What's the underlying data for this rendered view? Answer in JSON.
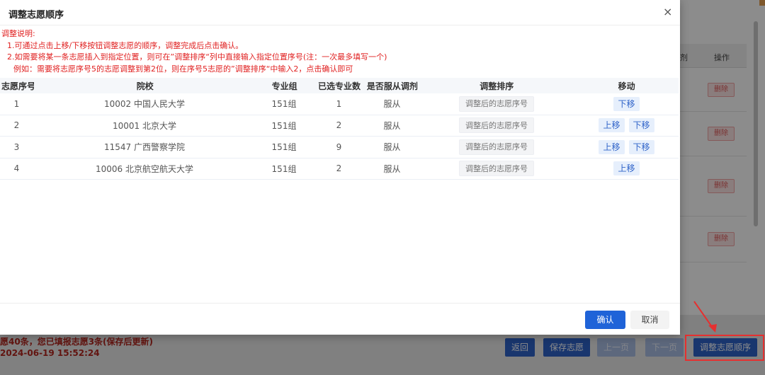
{
  "modal": {
    "title": "调整志愿顺序",
    "close_glyph": "×",
    "notes": {
      "heading": "调整说明:",
      "line1": "1.可通过点击上移/下移按钮调整志愿的顺序，调整完成后点击确认。",
      "line2": "2.如需要将某一条志愿插入到指定位置，则可在”调整排序“列中直接输入指定位置序号(注：一次最多填写一个)",
      "line3": "例如：需要将志愿序号5的志愿调整到第2位，则在序号5志愿的”调整排序“中输入2，点击确认即可"
    },
    "table": {
      "headers": [
        "志愿序号",
        "院校",
        "专业组",
        "已选专业数",
        "是否服从调剂",
        "调整排序",
        "移动"
      ],
      "rank_placeholder": "调整后的志愿序号",
      "up_label": "上移",
      "down_label": "下移",
      "rows": [
        {
          "index": "1",
          "school": "10002 中国人民大学",
          "group": "151组",
          "count": "1",
          "obey": "服从"
        },
        {
          "index": "2",
          "school": "10001 北京大学",
          "group": "151组",
          "count": "2",
          "obey": "服从"
        },
        {
          "index": "3",
          "school": "11547 广西警察学院",
          "group": "151组",
          "count": "9",
          "obey": "服从"
        },
        {
          "index": "4",
          "school": "10006 北京航空航天大学",
          "group": "151组",
          "count": "2",
          "obey": "服从"
        }
      ]
    },
    "footer": {
      "confirm_label": "确认",
      "cancel_label": "取消"
    }
  },
  "background": {
    "column_partial": "剂",
    "column_actions": "操作",
    "delete_label": "删除",
    "note_line1": "愿40条，您已填报志愿3条(保存后更新)",
    "note_line2": "2024-06-19 15:52:24",
    "buttons": {
      "back": "返回",
      "save": "保存志愿",
      "prev": "上一页",
      "next": "下一页",
      "adjust": "调整志愿顺序"
    }
  },
  "colors": {
    "primary": "#1f63d8",
    "danger_text": "#e02020",
    "highlight": "#e53030"
  }
}
